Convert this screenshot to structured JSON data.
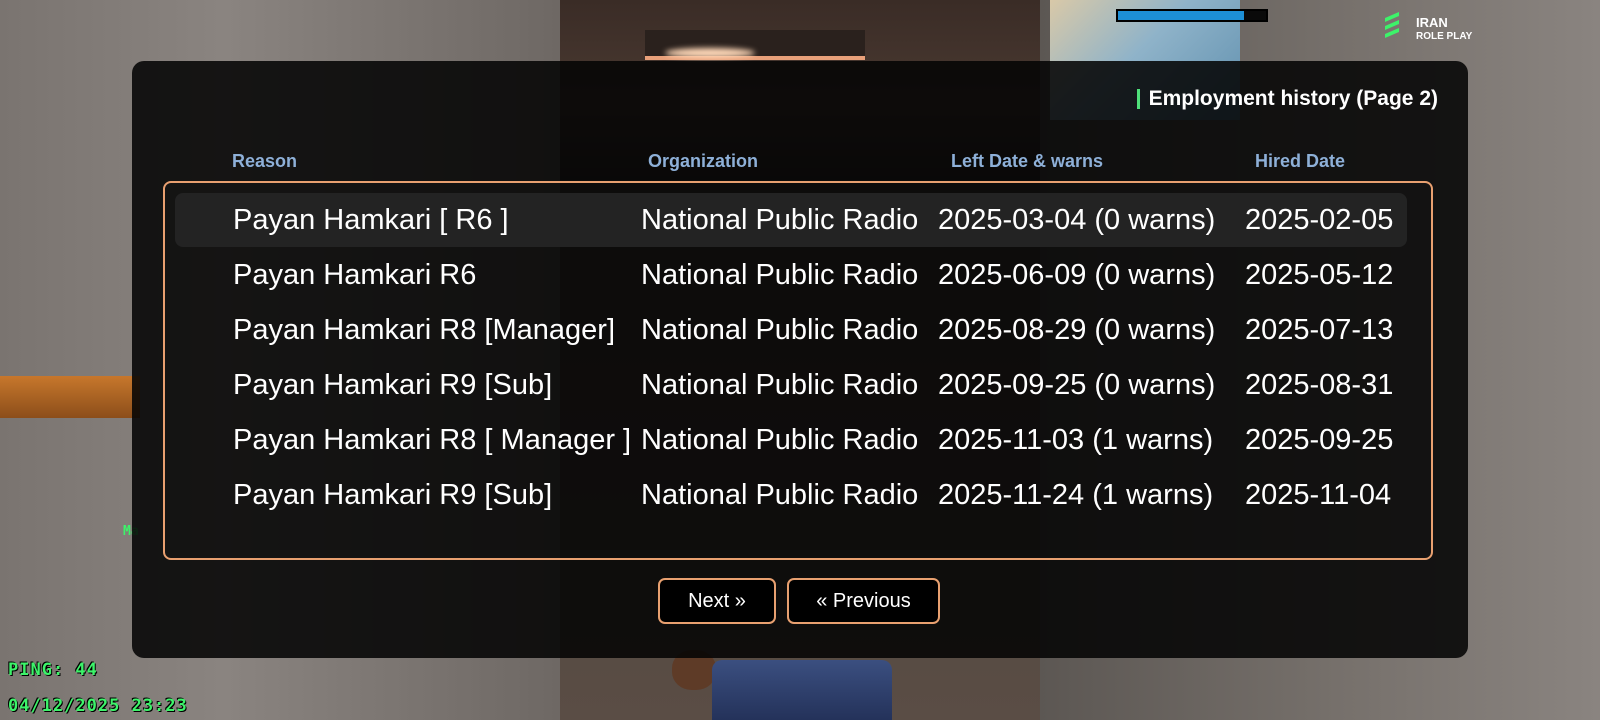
{
  "hud": {
    "health_fraction": 0.85,
    "health_color": "#1d8fd6",
    "logo_line1": "IRAN",
    "logo_line2": "ROLE PLAY",
    "ping_label": "PING: 44",
    "datetime": "04/12/2025 23:23"
  },
  "dialog": {
    "title": "Employment history (Page 2)",
    "columns": {
      "reason": "Reason",
      "organization": "Organization",
      "left_date": "Left Date & warns",
      "hired_date": "Hired Date"
    },
    "rows": [
      {
        "reason": "Payan Hamkari [ R6 ]",
        "organization": "National Public Radio",
        "left": "2025-03-04 (0 warns)",
        "hired": "2025-02-05"
      },
      {
        "reason": "Payan Hamkari R6",
        "organization": "National Public Radio",
        "left": "2025-06-09 (0 warns)",
        "hired": "2025-05-12"
      },
      {
        "reason": "Payan Hamkari R8 [Manager]",
        "organization": "National Public Radio",
        "left": "2025-08-29 (0 warns)",
        "hired": "2025-07-13"
      },
      {
        "reason": "Payan Hamkari R9 [Sub]",
        "organization": "National Public Radio",
        "left": "2025-09-25 (0 warns)",
        "hired": "2025-08-31"
      },
      {
        "reason": "Payan Hamkari R8 [ Manager ]",
        "organization": "National Public Radio",
        "left": "2025-11-03 (1 warns)",
        "hired": "2025-09-25"
      },
      {
        "reason": "Payan Hamkari R9 [Sub]",
        "organization": "National Public Radio",
        "left": "2025-11-24 (1 warns)",
        "hired": "2025-11-04"
      }
    ],
    "next_label": "Next »",
    "prev_label": "« Previous",
    "accent_color": "#e8a070"
  }
}
